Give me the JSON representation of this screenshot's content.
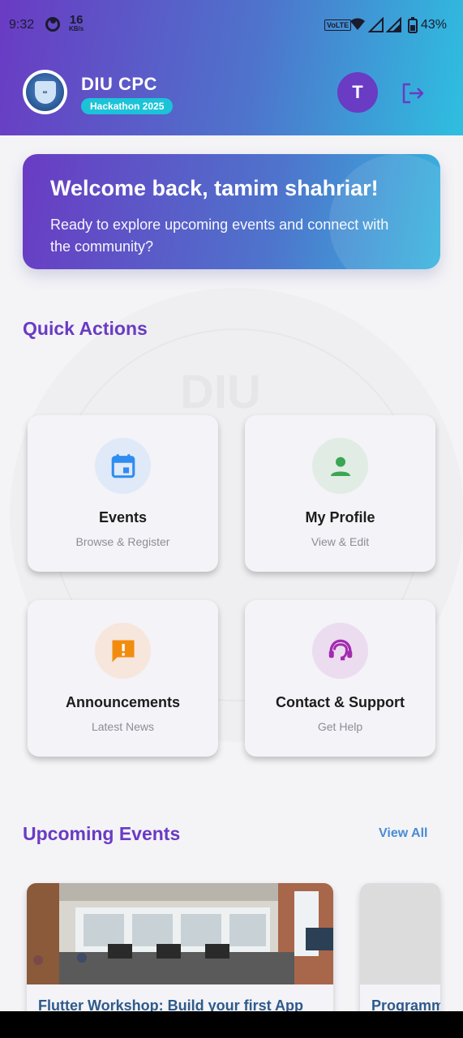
{
  "status_bar": {
    "time": "9:32",
    "net_speed_value": "16",
    "net_speed_unit": "KB/s",
    "volte": "VoLTE",
    "battery": "43%"
  },
  "header": {
    "app_title": "DIU CPC",
    "badge": "Hackathon 2025",
    "avatar_initial": "T",
    "logo_text": "DIU CPC"
  },
  "welcome": {
    "title": "Welcome back, tamim shahriar!",
    "subtitle": "Ready to explore upcoming events and connect with the community?"
  },
  "quick_actions": {
    "title": "Quick Actions",
    "items": [
      {
        "label": "Events",
        "sub": "Browse & Register",
        "icon": "calendar-icon"
      },
      {
        "label": "My Profile",
        "sub": "View & Edit",
        "icon": "person-icon"
      },
      {
        "label": "Announcements",
        "sub": "Latest News",
        "icon": "announcement-icon"
      },
      {
        "label": "Contact & Support",
        "sub": "Get Help",
        "icon": "support-agent-icon"
      }
    ]
  },
  "upcoming_events": {
    "title": "Upcoming Events",
    "view_all": "View All",
    "events": [
      {
        "title": "Flutter Workshop: Build your first App"
      },
      {
        "title": "Programm"
      }
    ]
  },
  "colors": {
    "primary": "#6a3bc3",
    "accent": "#2ebfe0",
    "link": "#4a8ad4"
  }
}
